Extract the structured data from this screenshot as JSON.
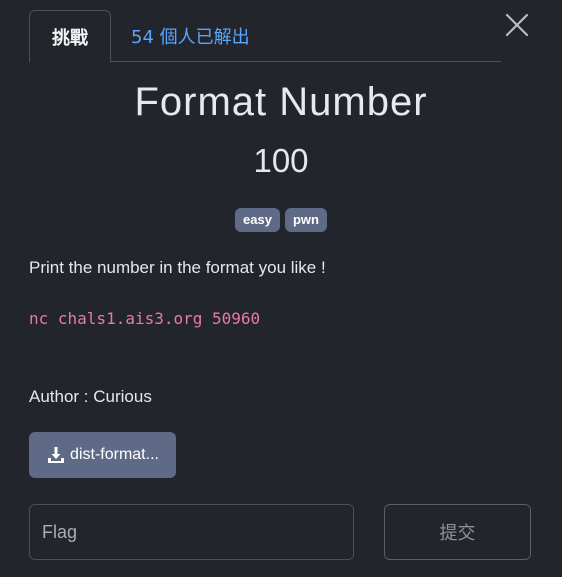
{
  "tabs": {
    "active_label": "挑戰",
    "solves_label": "54 個人已解出"
  },
  "challenge": {
    "title": "Format Number",
    "points": "100",
    "tags": [
      "easy",
      "pwn"
    ],
    "description": "Print the number in the format you like !",
    "connection": "nc chals1.ais3.org 50960",
    "author": "Author : Curious"
  },
  "download": {
    "label": "dist-format...",
    "icon": "download-icon"
  },
  "flag": {
    "placeholder": "Flag",
    "value": ""
  },
  "submit": {
    "label": "提交"
  },
  "icons": {
    "close": "close-icon"
  },
  "colors": {
    "background": "#22252b",
    "tab_link": "#58a6ff",
    "tag_bg": "#5f6b86",
    "code_text": "#e879a8"
  }
}
